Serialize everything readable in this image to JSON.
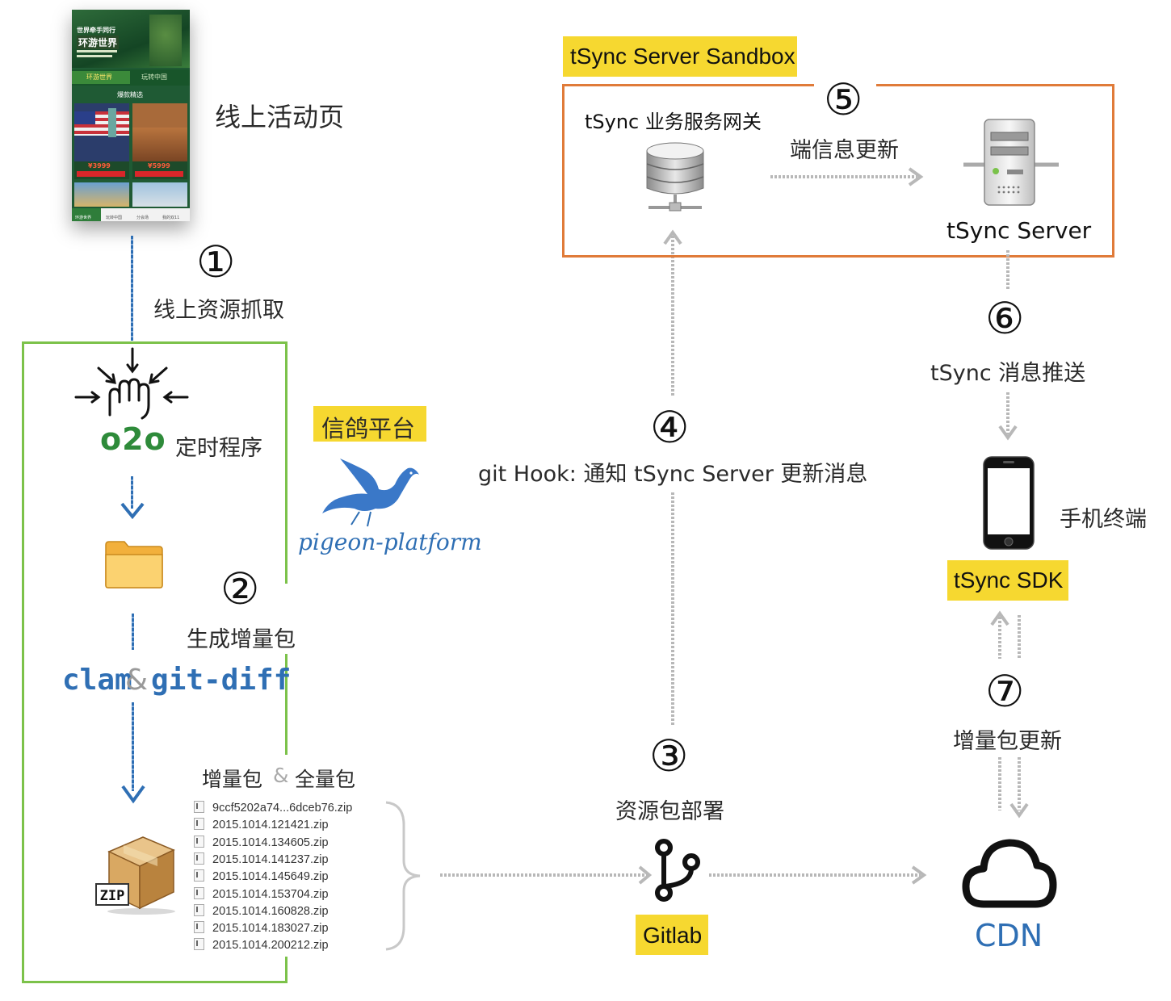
{
  "labels": {
    "online_page": "线上活动页",
    "step1_circle": "①",
    "step1": "线上资源抓取",
    "o2o": "o2o",
    "scheduler": "定时程序",
    "pigeon_box": "信鸽平台",
    "pigeon_logo": "pigeon-platform",
    "step2_circle": "②",
    "step2": "生成增量包",
    "clam": "clam",
    "amp": "&",
    "gitdiff": "git-diff",
    "incr_label": "增量包",
    "incr_amp": "&",
    "full_label": "全量包",
    "step3_circle": "③",
    "step3": "资源包部署",
    "gitlab": "Gitlab",
    "step4_circle": "④",
    "step4": "git Hook: 通知 tSync Server 更新消息",
    "sandbox_title": "tSync Server Sandbox",
    "gateway": "tSync 业务服务网关",
    "step5_circle": "⑤",
    "step5": "端信息更新",
    "server": "tSync Server",
    "step6_circle": "⑥",
    "step6": "tSync 消息推送",
    "phone": "手机终端",
    "sdk": "tSync SDK",
    "step7_circle": "⑦",
    "step7": "增量包更新",
    "cdn": "CDN"
  },
  "files": [
    "9ccf5202a74...6dceb76.zip",
    "2015.1014.121421.zip",
    "2015.1014.134605.zip",
    "2015.1014.141237.zip",
    "2015.1014.145649.zip",
    "2015.1014.153704.zip",
    "2015.1014.160828.zip",
    "2015.1014.183027.zip",
    "2015.1014.200212.zip"
  ],
  "screenshot": {
    "banner_line1": "世界牵手同行",
    "banner_title": "环游世界",
    "tab1": "环游世界",
    "tab2": "玩转中国",
    "section": "爆款精选",
    "price1": "¥3999",
    "price2": "¥5999",
    "nav1": "环游世界",
    "nav2": "玩转中国",
    "nav3": "分会场",
    "nav4": "我的双11"
  },
  "colors": {
    "yellow_label": "#f6d830",
    "blue_flow": "#2f6fb4",
    "green_frame": "#7cc24a",
    "orange_frame": "#e07b39",
    "o2o_green": "#2e8b3a",
    "clam_blue": "#2f6fb4",
    "cdn_blue": "#2f6fb4"
  }
}
